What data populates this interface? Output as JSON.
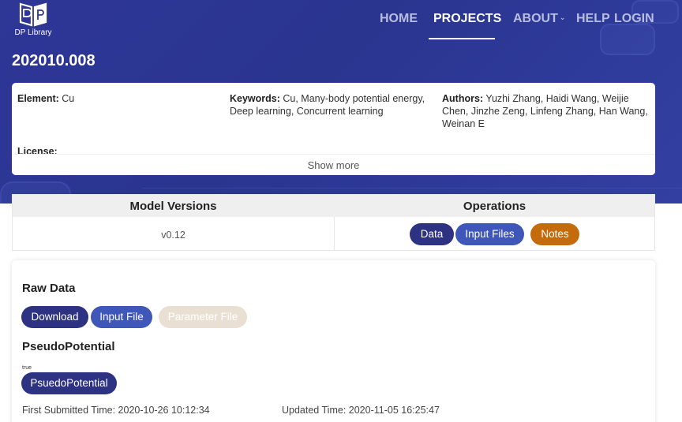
{
  "brand": {
    "name": "DP Library"
  },
  "nav": {
    "items": [
      {
        "label": "HOME"
      },
      {
        "label": "PROJECTS"
      },
      {
        "label": "ABOUT"
      },
      {
        "label": "HELP"
      },
      {
        "label": "LOGIN"
      }
    ],
    "active": "PROJECTS"
  },
  "project": {
    "title": "202010.008",
    "element": {
      "label": "Element:",
      "value": " Cu"
    },
    "keywords": {
      "label": "Keywords:",
      "value": " Cu, Many-body potential energy, Deep learning, Concurrent learning"
    },
    "authors": {
      "label": "Authors:",
      "value": " Yuzhi Zhang, Haidi Wang, Weijie Chen, Jinzhe Zeng, Linfeng Zhang, Han Wang, Weinan E"
    },
    "license_label": "License:",
    "show_more": "Show more"
  },
  "versions_table": {
    "headers": [
      "Model Versions",
      "Operations"
    ],
    "version": "v0.12",
    "operations": [
      "Data",
      "Input Files",
      "Notes"
    ]
  },
  "raw_data": {
    "title": "Raw Data",
    "buttons": [
      "Download",
      "Input File",
      "Parameter File"
    ],
    "pseudo_title": "PseudoPotential",
    "pseudo_flag": "true",
    "pseudo_button": "PsuedoPotential",
    "first_submitted": "First Submitted Time: 2020-10-26 10:12:34",
    "updated": "Updated Time: 2020-11-05 16:25:47"
  },
  "colors": {
    "hero": "#2e3696",
    "navy_button": "#2d3282",
    "blue_button": "#3f57b8",
    "orange_button": "#c46c0c",
    "disabled_button": "#eadfd3"
  }
}
